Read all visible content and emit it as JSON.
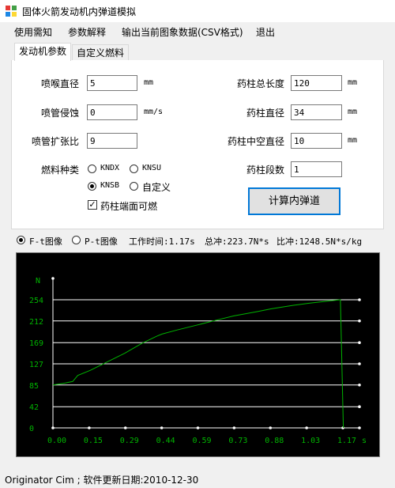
{
  "window": {
    "title": "固体火箭发动机内弹道模拟"
  },
  "menu": {
    "items": [
      "使用需知",
      "参数解释",
      "输出当前图象数据(CSV格式)",
      "退出"
    ]
  },
  "tabs": [
    "发动机参数",
    "自定义燃料"
  ],
  "left_params": [
    {
      "label": "喷喉直径",
      "value": "5",
      "unit": "mm"
    },
    {
      "label": "喷管侵蚀",
      "value": "0",
      "unit": "mm/s"
    },
    {
      "label": "喷管扩张比",
      "value": "9",
      "unit": ""
    }
  ],
  "right_params": [
    {
      "label": "药柱总长度",
      "value": "120",
      "unit": "mm"
    },
    {
      "label": "药柱直径",
      "value": "34",
      "unit": "mm"
    },
    {
      "label": "药柱中空直径",
      "value": "10",
      "unit": "mm"
    },
    {
      "label": "药柱段数",
      "value": "1",
      "unit": ""
    }
  ],
  "fuel": {
    "label": "燃料种类",
    "options": [
      {
        "label": "KNDX",
        "selected": false
      },
      {
        "label": "KNSU",
        "selected": false
      },
      {
        "label": "KNSB",
        "selected": true
      },
      {
        "label": "自定义",
        "selected": false
      }
    ],
    "end_burn": {
      "label": "药柱端面可燃",
      "checked": true
    }
  },
  "calc_button": "计算内弹道",
  "plot_options": {
    "ft": {
      "label": "F-t图像",
      "selected": true
    },
    "pt": {
      "label": "P-t图像",
      "selected": false
    }
  },
  "results": {
    "work_time": "工作时间:1.17s",
    "total_impulse": "总冲:223.7N*s",
    "specific_impulse": "比冲:1248.5N*s/kg"
  },
  "chart_data": {
    "type": "line",
    "ylabel": "N",
    "xlabel": "s",
    "x_ticks": [
      "0.00",
      "0.15",
      "0.29",
      "0.44",
      "0.59",
      "0.73",
      "0.88",
      "1.03",
      "1.17"
    ],
    "y_ticks": [
      "0",
      "42",
      "85",
      "127",
      "169",
      "212",
      "254"
    ],
    "xlim": [
      0,
      1.17
    ],
    "ylim": [
      0,
      254
    ],
    "grid": true,
    "colors": {
      "background": "#000000",
      "axis": "#ffffff",
      "text": "#00b400",
      "line": "#00b400"
    },
    "series": [
      {
        "x": [
          0.0,
          0.05,
          0.08,
          0.1,
          0.15,
          0.22,
          0.29,
          0.36,
          0.42,
          0.44,
          0.5,
          0.59,
          0.68,
          0.73,
          0.82,
          0.88,
          0.97,
          1.03,
          1.12,
          1.16,
          1.172
        ],
        "y": [
          85,
          89,
          92,
          104,
          114,
          131,
          148,
          168,
          182,
          186,
          194,
          205,
          216,
          222,
          230,
          236,
          243,
          247,
          252,
          254,
          0
        ]
      }
    ]
  },
  "status": {
    "text": "Originator Cim ; 软件更新日期:2010-12-30"
  }
}
